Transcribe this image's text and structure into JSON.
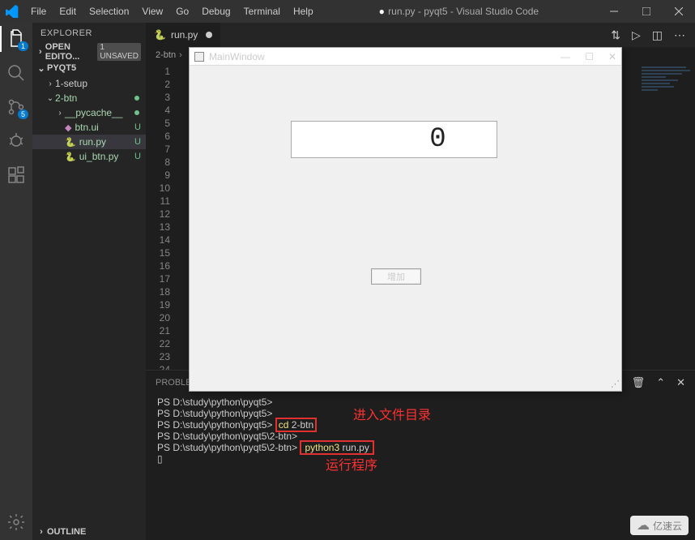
{
  "titlebar": {
    "menus": [
      "File",
      "Edit",
      "Selection",
      "View",
      "Go",
      "Debug",
      "Terminal",
      "Help"
    ],
    "title_prefix": "●",
    "title": "run.py - pyqt5 - Visual Studio Code"
  },
  "activitybar": {
    "explorer_badge": "1",
    "scm_badge": "5"
  },
  "sidebar": {
    "title": "EXPLORER",
    "open_editors": {
      "label": "OPEN EDITO...",
      "badge": "1 UNSAVED"
    },
    "root": "PYQT5",
    "tree": {
      "setup": "1-setup",
      "btn": "2-btn",
      "pycache": "__pycache__",
      "btnui": "btn.ui",
      "runpy": "run.py",
      "uibtnpy": "ui_btn.py"
    },
    "git_u": "U",
    "outline": "OUTLINE"
  },
  "tabs": {
    "active": "run.py"
  },
  "breadcrumb": {
    "a": "2-btn",
    "sep": "›"
  },
  "editor": {
    "lines": [
      "1",
      "2",
      "3",
      "4",
      "5",
      "6",
      "7",
      "8",
      "9",
      "10",
      "11",
      "12",
      "13",
      "14",
      "15",
      "16",
      "17",
      "18",
      "19",
      "20",
      "21",
      "22",
      "23",
      "24"
    ],
    "str_fragment": "\")"
  },
  "panel": {
    "tab": "PROBLEM",
    "lines": [
      "PS D:\\study\\python\\pyqt5>",
      "PS D:\\study\\python\\pyqt5>",
      "PS D:\\study\\python\\pyqt5>",
      "PS D:\\study\\python\\pyqt5\\2-btn>",
      "PS D:\\study\\python\\pyqt5\\2-btn>"
    ],
    "cmd1_a": "cd",
    "cmd1_b": "2-btn",
    "cmd2_a": "python3",
    "cmd2_b": "run.py",
    "cursor": "▯",
    "annot1": "进入文件目录",
    "annot2": "运行程序"
  },
  "mainwindow": {
    "title": "MainWindow",
    "lcd": "0",
    "button": "增加"
  },
  "watermark": "亿速云"
}
